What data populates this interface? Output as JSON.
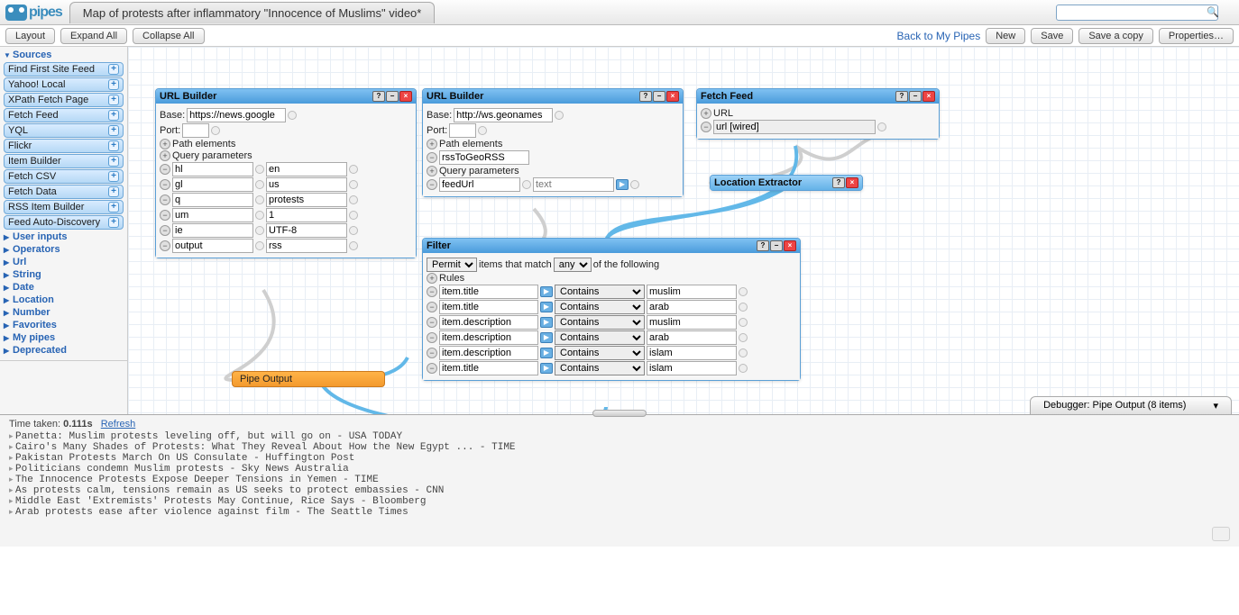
{
  "header": {
    "logo_text": "pipes",
    "tab_title": "Map of protests after inflammatory \"Innocence of Muslims\" video*",
    "search_placeholder": ""
  },
  "toolbar": {
    "layout": "Layout",
    "expand": "Expand All",
    "collapse": "Collapse All",
    "back": "Back to My Pipes",
    "new": "New",
    "save": "Save",
    "save_copy": "Save a copy",
    "properties": "Properties…"
  },
  "sidebar": {
    "sources_label": "Sources",
    "sources": [
      "Find First Site Feed",
      "Yahoo! Local",
      "XPath Fetch Page",
      "Fetch Feed",
      "YQL",
      "Flickr",
      "Item Builder",
      "Fetch CSV",
      "Fetch Data",
      "RSS Item Builder",
      "Feed Auto-Discovery"
    ],
    "categories": [
      "User inputs",
      "Operators",
      "Url",
      "String",
      "Date",
      "Location",
      "Number",
      "Favorites",
      "My pipes",
      "Deprecated"
    ]
  },
  "canvas": {
    "url_builder_1": {
      "title": "URL Builder",
      "base_label": "Base:",
      "base_value": "https://news.google",
      "port_label": "Port:",
      "path_label": "Path elements",
      "query_label": "Query parameters",
      "params": [
        {
          "k": "hl",
          "v": "en"
        },
        {
          "k": "gl",
          "v": "us"
        },
        {
          "k": "q",
          "v": "protests"
        },
        {
          "k": "um",
          "v": "1"
        },
        {
          "k": "ie",
          "v": "UTF-8"
        },
        {
          "k": "output",
          "v": "rss"
        }
      ]
    },
    "url_builder_2": {
      "title": "URL Builder",
      "base_label": "Base:",
      "base_value": "http://ws.geonames",
      "port_label": "Port:",
      "path_label": "Path elements",
      "path_value": "rssToGeoRSS",
      "query_label": "Query parameters",
      "params": [
        {
          "k": "feedUrl",
          "v": "",
          "ph": "text"
        }
      ]
    },
    "fetch_feed": {
      "title": "Fetch Feed",
      "url_label": "URL",
      "url_value": "url [wired]"
    },
    "location_extractor": {
      "title": "Location Extractor"
    },
    "filter": {
      "title": "Filter",
      "permit": "Permit",
      "items_that_match": "items that match",
      "any": "any",
      "of_following": "of the following",
      "rules_label": "Rules",
      "contains": "Contains",
      "rules": [
        {
          "field": "item.title",
          "op": "Contains",
          "v": "muslim"
        },
        {
          "field": "item.title",
          "op": "Contains",
          "v": "arab"
        },
        {
          "field": "item.description",
          "op": "Contains",
          "v": "muslim"
        },
        {
          "field": "item.description",
          "op": "Contains",
          "v": "arab"
        },
        {
          "field": "item.description",
          "op": "Contains",
          "v": "islam"
        },
        {
          "field": "item.title",
          "op": "Contains",
          "v": "islam"
        }
      ]
    },
    "pipe_output": "Pipe Output"
  },
  "debugger": {
    "tab_label": "Debugger: Pipe Output (8 items)",
    "time_label": "Time taken:",
    "time_value": "0.111s",
    "refresh": "Refresh",
    "items": [
      "Panetta: Muslim protests leveling off, but will go on - USA TODAY",
      "Cairo's Many Shades of Protests: What They Reveal About How the New Egypt ... - TIME",
      "Pakistan Protests March On US Consulate - Huffington Post",
      "Politicians condemn Muslim protests - Sky News Australia",
      "The Innocence Protests Expose Deeper Tensions in Yemen - TIME",
      "As protests calm, tensions remain as US seeks to protect embassies - CNN",
      "Middle East 'Extremists' Protests May Continue, Rice Says - Bloomberg",
      "Arab protests ease after violence against film - The Seattle Times"
    ]
  }
}
